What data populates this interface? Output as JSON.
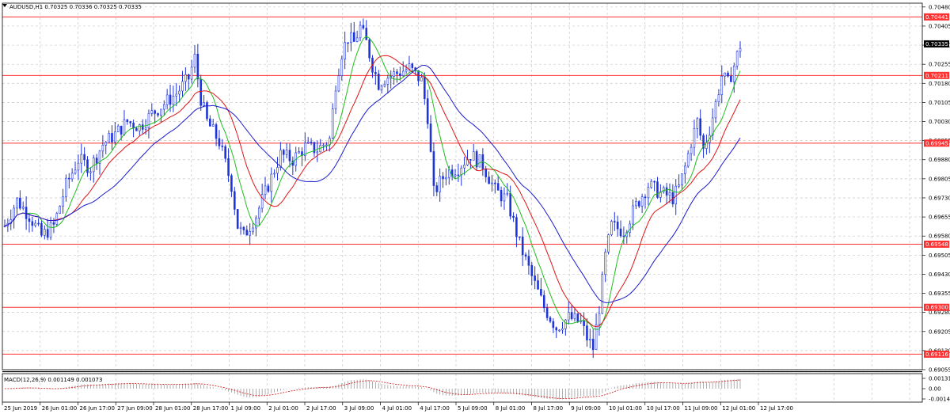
{
  "header": {
    "symbol_line": "AUDUSD,H1  0.70325 0.70336 0.70325 0.70335"
  },
  "indicator": {
    "label": "MACD(12,26,9) 0.001149 0.001073"
  },
  "colors": {
    "candle": "#1f35d8",
    "ma_fast": "#1fbf1f",
    "ma_mid": "#e01414",
    "ma_slow": "#1a1ad0",
    "level_line": "#ff3030",
    "grid": "#c9c9c9",
    "macd": "#9a9a9a",
    "signal": "#d01414",
    "current_price_bg": "#000000"
  },
  "chart_data": [
    {
      "type": "candlestick",
      "title": "AUDUSD,H1",
      "ohlc_header": "0.70325 0.70336 0.70325 0.70335",
      "ylim": [
        0.69055,
        0.70495
      ],
      "y_ticks": [
        "0.70480",
        "0.70405",
        "0.70330",
        "0.70255",
        "0.70180",
        "0.70105",
        "0.70030",
        "0.69955",
        "0.69880",
        "0.69805",
        "0.69730",
        "0.69655",
        "0.69580",
        "0.69505",
        "0.69430",
        "0.69355",
        "0.69280",
        "0.69205",
        "0.69130",
        "0.69055"
      ],
      "x_ticks": [
        "25 Jun 2019",
        "26 Jun 01:00",
        "26 Jun 17:00",
        "27 Jun 09:00",
        "28 Jun 01:00",
        "28 Jun 17:00",
        "1 Jul 09:00",
        "2 Jul 01:00",
        "2 Jul 17:00",
        "3 Jul 09:00",
        "4 Jul 01:00",
        "4 Jul 17:00",
        "5 Jul 09:00",
        "8 Jul 01:00",
        "8 Jul 17:00",
        "9 Jul 09:00",
        "10 Jul 01:00",
        "10 Jul 17:00",
        "11 Jul 09:00",
        "12 Jul 01:00",
        "12 Jul 17:00"
      ],
      "horizontal_levels": [
        {
          "label": "0.70441",
          "value": 0.70441
        },
        {
          "label": "0.70211",
          "value": 0.70211
        },
        {
          "label": "0.69945",
          "value": 0.69945
        },
        {
          "label": "0.69548",
          "value": 0.69548
        },
        {
          "label": "0.69300",
          "value": 0.693
        },
        {
          "label": "0.69116",
          "value": 0.69116
        }
      ],
      "current_price": {
        "label": "0.70335",
        "value": 0.70335
      },
      "price_path": [
        [
          0,
          0.6962
        ],
        [
          4,
          0.6972
        ],
        [
          8,
          0.6966
        ],
        [
          12,
          0.6958
        ],
        [
          16,
          0.6962
        ],
        [
          20,
          0.6978
        ],
        [
          24,
          0.6988
        ],
        [
          28,
          0.6985
        ],
        [
          32,
          0.6994
        ],
        [
          36,
          0.6998
        ],
        [
          40,
          0.7003
        ],
        [
          44,
          0.7001
        ],
        [
          48,
          0.7006
        ],
        [
          52,
          0.701
        ],
        [
          56,
          0.7014
        ],
        [
          60,
          0.702
        ],
        [
          62,
          0.7028
        ],
        [
          64,
          0.7012
        ],
        [
          66,
          0.7003
        ],
        [
          70,
          0.6995
        ],
        [
          74,
          0.6978
        ],
        [
          76,
          0.6962
        ],
        [
          78,
          0.6958
        ],
        [
          82,
          0.6966
        ],
        [
          86,
          0.6978
        ],
        [
          90,
          0.699
        ],
        [
          94,
          0.6988
        ],
        [
          98,
          0.6993
        ],
        [
          102,
          0.6992
        ],
        [
          106,
          0.6996
        ],
        [
          108,
          0.7018
        ],
        [
          110,
          0.703
        ],
        [
          112,
          0.7036
        ],
        [
          114,
          0.7034
        ],
        [
          116,
          0.704
        ],
        [
          118,
          0.7034
        ],
        [
          120,
          0.7025
        ],
        [
          122,
          0.7018
        ],
        [
          124,
          0.702
        ],
        [
          128,
          0.7022
        ],
        [
          132,
          0.7024
        ],
        [
          136,
          0.7019
        ],
        [
          138,
          0.7005
        ],
        [
          140,
          0.6975
        ],
        [
          144,
          0.6983
        ],
        [
          148,
          0.6985
        ],
        [
          152,
          0.699
        ],
        [
          156,
          0.6986
        ],
        [
          160,
          0.6976
        ],
        [
          164,
          0.6972
        ],
        [
          168,
          0.6955
        ],
        [
          172,
          0.6942
        ],
        [
          176,
          0.693
        ],
        [
          180,
          0.6922
        ],
        [
          184,
          0.6926
        ],
        [
          188,
          0.6924
        ],
        [
          190,
          0.6918
        ],
        [
          192,
          0.6914
        ],
        [
          194,
          0.693
        ],
        [
          196,
          0.695
        ],
        [
          198,
          0.6962
        ],
        [
          202,
          0.696
        ],
        [
          206,
          0.697
        ],
        [
          210,
          0.6978
        ],
        [
          214,
          0.6975
        ],
        [
          218,
          0.6973
        ],
        [
          220,
          0.6977
        ],
        [
          222,
          0.6985
        ],
        [
          224,
          0.6995
        ],
        [
          226,
          0.7003
        ],
        [
          228,
          0.6992
        ],
        [
          230,
          0.7
        ],
        [
          232,
          0.701
        ],
        [
          234,
          0.7021
        ],
        [
          236,
          0.7018
        ],
        [
          238,
          0.7025
        ],
        [
          240,
          0.7033
        ]
      ],
      "ma_fast_period_hint": "green",
      "ma_mid_period_hint": "red",
      "ma_slow_period_hint": "blue"
    },
    {
      "type": "histogram",
      "title": "MACD(12,26,9)",
      "values_label": "0.001149 0.001073",
      "y_ticks": [
        "0.00131",
        "0.00",
        "-0.001471"
      ]
    }
  ]
}
